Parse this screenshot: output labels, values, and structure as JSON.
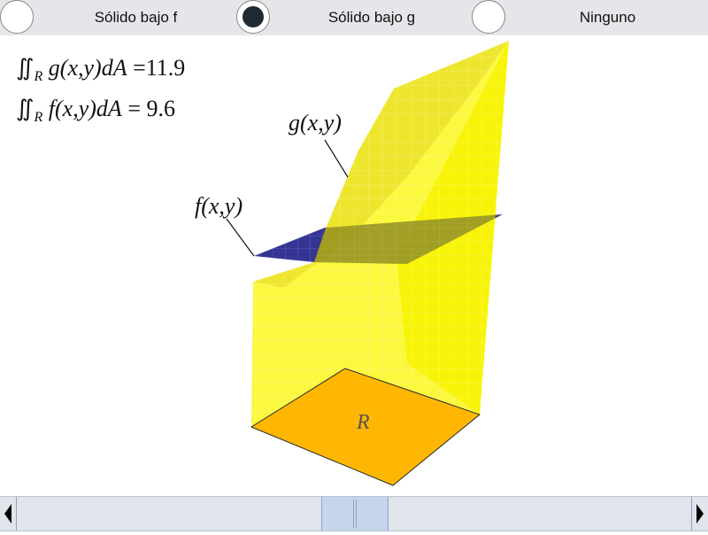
{
  "options": [
    {
      "label": "Sólido bajo f",
      "selected": false
    },
    {
      "label": "Sólido bajo g",
      "selected": true
    },
    {
      "label": "Ninguno",
      "selected": false
    }
  ],
  "formulas": {
    "g_integral": {
      "integrand": "g(x,y)dA",
      "value": "=11.9"
    },
    "f_integral": {
      "integrand": "f(x,y)dA",
      "value": "= 9.6"
    },
    "region_subscript": "R"
  },
  "labels": {
    "g_surface": "g(x,y)",
    "f_surface": "f(x,y)",
    "region": "R"
  },
  "colors": {
    "g_surface": "#f5f000",
    "f_surface": "#1f1f8a",
    "region": "#ffb300",
    "selected_dot": "#1f2a33"
  },
  "icons": {
    "scroll_left": "left-arrow-icon",
    "scroll_right": "right-arrow-icon"
  }
}
